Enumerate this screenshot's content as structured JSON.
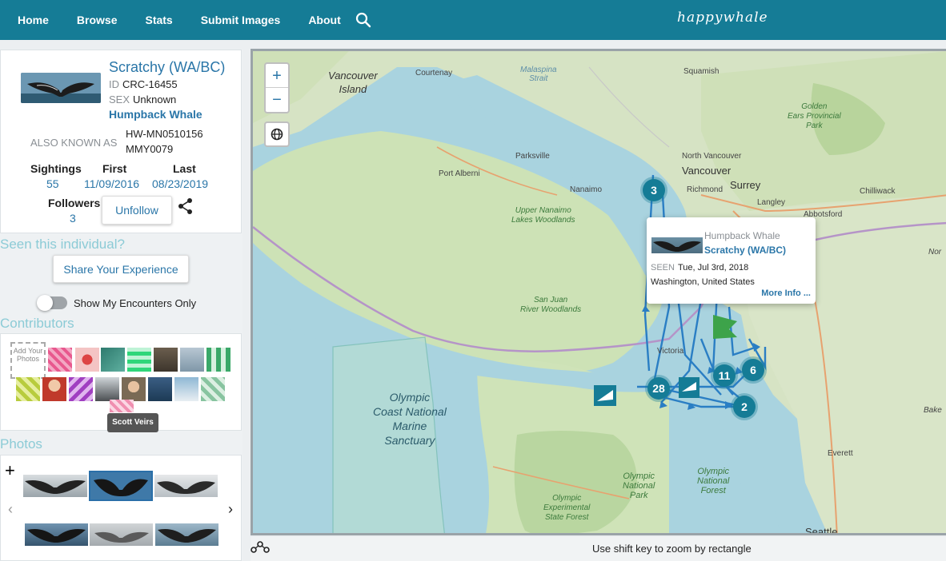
{
  "nav": {
    "items": [
      "Home",
      "Browse",
      "Stats",
      "Submit Images",
      "About"
    ],
    "logo": "happywhale"
  },
  "profile": {
    "name": "Scratchy (WA/BC)",
    "id_label": "ID",
    "id_value": "CRC-16455",
    "sex_label": "SEX",
    "sex_value": "Unknown",
    "species": "Humpback Whale",
    "aka_label": "ALSO KNOWN AS",
    "aka": [
      "HW-MN0510156",
      "MMY0079"
    ],
    "sightings_label": "Sightings",
    "sightings_value": "55",
    "first_label": "First",
    "first_value": "11/09/2016",
    "last_label": "Last",
    "last_value": "08/23/2019",
    "followers_label": "Followers",
    "followers_value": "3",
    "unfollow_label": "Unfollow"
  },
  "seen": {
    "heading": "Seen this individual?",
    "share_button": "Share Your Experience",
    "toggle_label": "Show My Encounters Only"
  },
  "contributors": {
    "heading": "Contributors",
    "add_photos": "Add Your Photos",
    "tooltip": "Scott Veirs"
  },
  "photos": {
    "heading": "Photos"
  },
  "map": {
    "zoom_in": "+",
    "zoom_out": "−",
    "clusters": [
      "3",
      "28",
      "11",
      "6",
      "2"
    ],
    "labels": {
      "vancouver_island": "Vancouver\nIsland",
      "courtenay": "Courtenay",
      "malaspina": "Malaspina\nStrait",
      "squamish": "Squamish",
      "golden_ears": "Golden\nEars Provincial\nPark",
      "parksville": "Parksville",
      "north_vancouver": "North Vancouver",
      "vancouver": "Vancouver",
      "port_alberni": "Port Alberni",
      "nanaimo": "Nanaimo",
      "richmond": "Richmond",
      "surrey": "Surrey",
      "chilliwack": "Chilliwack",
      "langley": "Langley",
      "abbotsford": "Abbotsford",
      "upper_nanaimo": "Upper Nanaimo\nLakes Woodlands",
      "san_juan": "San Juan\nRiver Woodlands",
      "victoria": "Victoria",
      "olympic_marine": "Olympic\nCoast National\nMarine\nSanctuary",
      "olympic_np": "Olympic\nNational\nPark",
      "olympic_nf": "Olympic\nNational\nForest",
      "olympic_exp": "Olympic\nExperimental\nState Forest",
      "everett": "Everett",
      "seattle": "Seattle",
      "nor": "Nor",
      "bake": "Bake"
    },
    "popup": {
      "type": "Humpback Whale",
      "name": "Scratchy (WA/BC)",
      "seen_label": "SEEN",
      "seen_value": "Tue, Jul 3rd, 2018",
      "location": "Washington, United States",
      "more": "More Info ..."
    },
    "hint": "Use shift key to zoom by rectangle"
  },
  "colors": {
    "brand": "#157c96",
    "link": "#2a76a8",
    "section": "#8ccbd6"
  }
}
